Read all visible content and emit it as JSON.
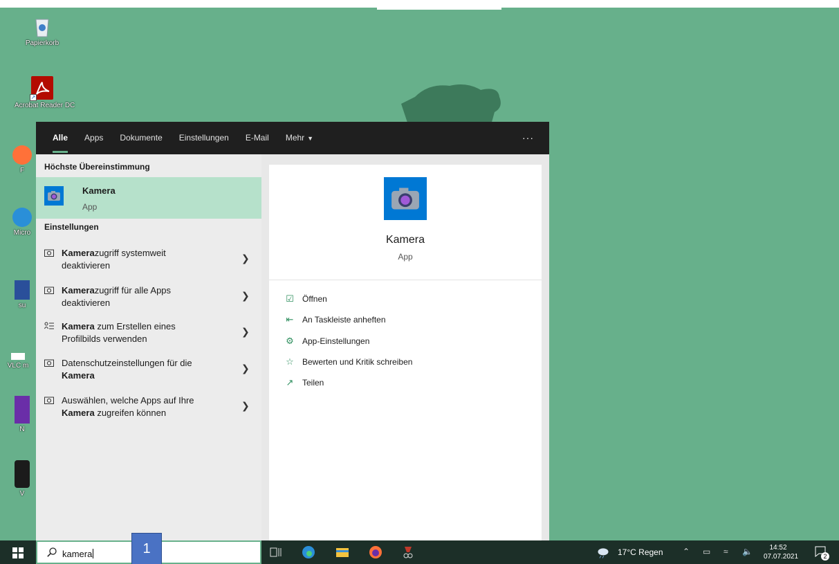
{
  "desktop": {
    "icons": [
      {
        "label": "Papierkorb"
      },
      {
        "label": "Acrobat Reader DC"
      },
      {
        "label": "F"
      },
      {
        "label": "Micro"
      },
      {
        "label": "su"
      },
      {
        "label": "VLC m"
      },
      {
        "label": "N"
      },
      {
        "label": "V"
      }
    ]
  },
  "search": {
    "tabs": [
      {
        "label": "Alle",
        "active": true
      },
      {
        "label": "Apps"
      },
      {
        "label": "Dokumente"
      },
      {
        "label": "Einstellungen"
      },
      {
        "label": "E-Mail"
      },
      {
        "label": "Mehr"
      }
    ],
    "more_options": "···",
    "best_match_header": "Höchste Übereinstimmung",
    "best_match": {
      "title": "Kamera",
      "subtitle": "App",
      "icon": "camera-icon"
    },
    "settings_header": "Einstellungen",
    "settings_items": [
      {
        "bold": "Kamera",
        "rest_line1": "zugriff systemweit",
        "line2": "deaktivieren",
        "icon": "camera-outline-icon"
      },
      {
        "bold": "Kamera",
        "rest_line1": "zugriff für alle Apps",
        "line2": "deaktivieren",
        "icon": "camera-outline-icon"
      },
      {
        "bold": "Kamera",
        "rest_line1": " zum Erstellen eines",
        "line2": "Profilbilds verwenden",
        "icon": "profile-list-icon"
      },
      {
        "line1": "Datenschutzeinstellungen für die",
        "bold2": "Kamera",
        "icon": "camera-outline-icon"
      },
      {
        "line1": "Auswählen, welche Apps auf Ihre",
        "bold2": "Kamera",
        "rest_line2": " zugreifen können",
        "icon": "camera-outline-icon"
      }
    ],
    "preview": {
      "title": "Kamera",
      "subtitle": "App",
      "actions": [
        {
          "label": "Öffnen",
          "icon": "open-icon"
        },
        {
          "label": "An Taskleiste anheften",
          "icon": "pin-icon"
        },
        {
          "label": "App-Einstellungen",
          "icon": "gear-icon"
        },
        {
          "label": "Bewerten und Kritik schreiben",
          "icon": "star-list-icon"
        },
        {
          "label": "Teilen",
          "icon": "share-icon"
        }
      ]
    }
  },
  "taskbar": {
    "search_value": "kamera",
    "step_badge": "1",
    "weather": "17°C Regen",
    "time": "14:52",
    "date": "07.07.2021",
    "notification_count": "2"
  },
  "colors": {
    "desktop": "#67b08b",
    "accent": "#67b08b",
    "best_match_bg": "#b6e1cb",
    "app_tile": "#0078d4",
    "taskbar": "#1c2f28"
  }
}
